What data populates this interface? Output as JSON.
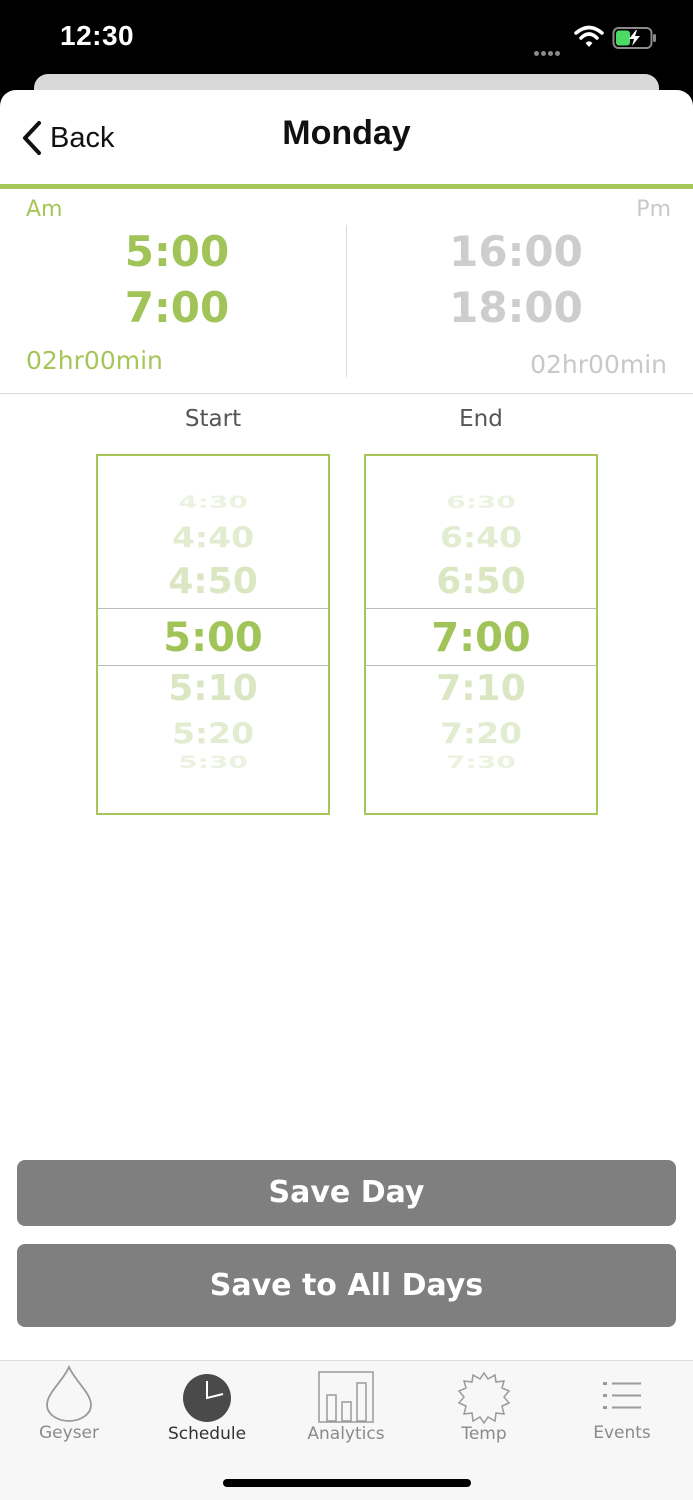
{
  "status_bar": {
    "time": "12:30"
  },
  "nav": {
    "back_label": "Back",
    "title": "Monday"
  },
  "summary": {
    "am_label": "Am",
    "pm_label": "Pm",
    "am_start": "5:00",
    "am_end": "7:00",
    "am_duration": "02hr00min",
    "pm_start": "16:00",
    "pm_end": "18:00",
    "pm_duration": "02hr00min"
  },
  "pickers": {
    "start_label": "Start",
    "end_label": "End",
    "start": {
      "items": [
        "4:30",
        "4:40",
        "4:50",
        "5:00",
        "5:10",
        "5:20",
        "5:30"
      ],
      "selected": "5:00"
    },
    "end": {
      "items": [
        "6:30",
        "6:40",
        "6:50",
        "7:00",
        "7:10",
        "7:20",
        "7:30"
      ],
      "selected": "7:00"
    }
  },
  "buttons": {
    "save_day": "Save Day",
    "save_all": "Save to All Days"
  },
  "tabs": [
    {
      "label": "Geyser",
      "icon": "drop-icon"
    },
    {
      "label": "Schedule",
      "icon": "clock-icon",
      "active": true
    },
    {
      "label": "Analytics",
      "icon": "bar-chart-icon"
    },
    {
      "label": "Temp",
      "icon": "gear-icon"
    },
    {
      "label": "Events",
      "icon": "list-icon"
    }
  ],
  "colors": {
    "accent": "#a6c65a",
    "button": "#7f7f7f",
    "inactive": "#c8c8c8"
  }
}
